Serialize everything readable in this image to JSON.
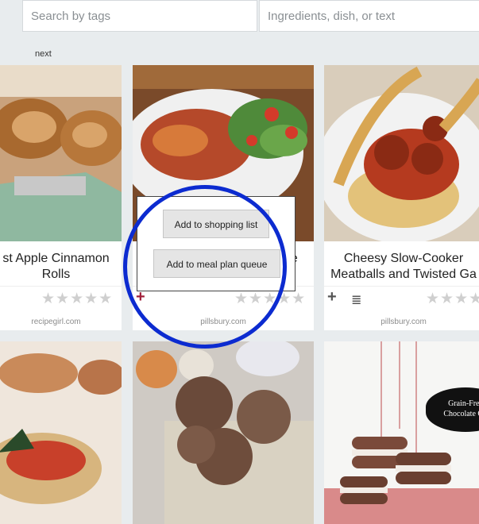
{
  "search": {
    "tags_placeholder": "Search by tags",
    "text_placeholder": "Ingredients, dish, or text"
  },
  "pager": {
    "next_label": "next"
  },
  "cards": [
    {
      "title_line1": "st Apple Cinnamon",
      "title_line2": "Rolls",
      "source": "recipegirl.com",
      "stars": "★★★★★"
    },
    {
      "title_visible": "pe",
      "source": "pillsbury.com",
      "stars": "★★★★★",
      "add_icon": "+"
    },
    {
      "title_line1": "Cheesy Slow-Cooker",
      "title_line2": "Meatballs and Twisted Ga",
      "source": "pillsbury.com",
      "stars": "★★★★",
      "add_icon": "+",
      "list_icon": "≣"
    }
  ],
  "bottom_cards": [
    {
      "badge_line1": "Grain-Free",
      "badge_line2": "Chocolate Oh"
    }
  ],
  "popup": {
    "shopping_label": "Add to shopping list",
    "meal_plan_label": "Add to meal plan queue"
  },
  "colors": {
    "highlight_circle": "#0c2bd0",
    "active_plus": "#a0203a",
    "stars": "#cfcfcf"
  },
  "icons": [
    "plus-icon",
    "list-icon",
    "star-icon"
  ]
}
